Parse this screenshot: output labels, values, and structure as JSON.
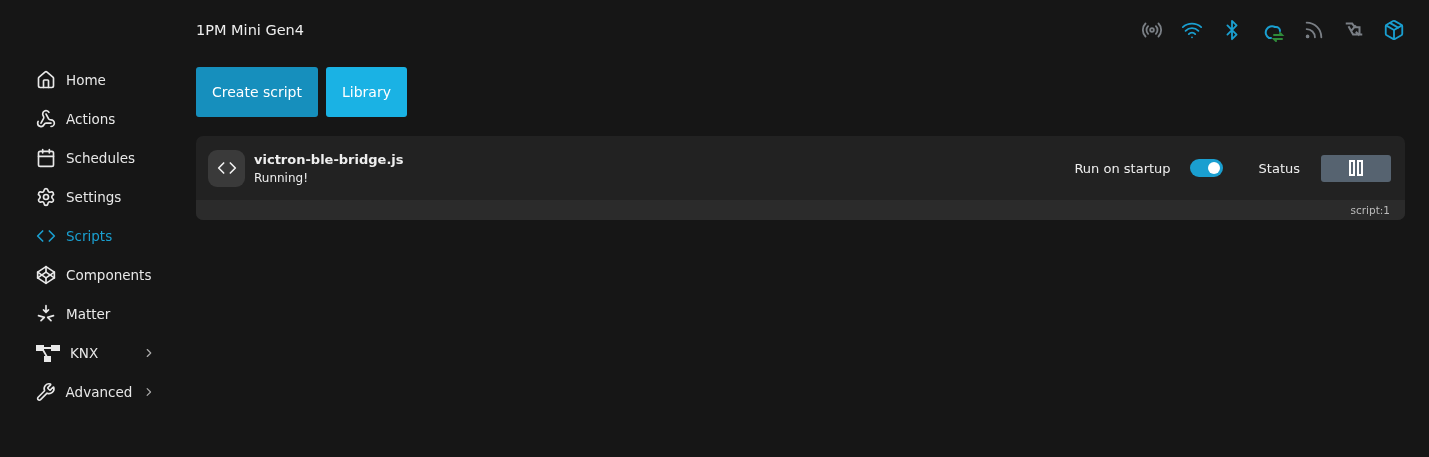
{
  "sidebar": {
    "items": [
      {
        "label": "Home",
        "kind": "home",
        "selected": false,
        "has_submenu": false
      },
      {
        "label": "Actions",
        "kind": "actions",
        "selected": false,
        "has_submenu": false
      },
      {
        "label": "Schedules",
        "kind": "schedules",
        "selected": false,
        "has_submenu": false
      },
      {
        "label": "Settings",
        "kind": "settings",
        "selected": false,
        "has_submenu": false
      },
      {
        "label": "Scripts",
        "kind": "scripts",
        "selected": true,
        "has_submenu": false
      },
      {
        "label": "Components",
        "kind": "components",
        "selected": false,
        "has_submenu": false
      },
      {
        "label": "Matter",
        "kind": "matter",
        "selected": false,
        "has_submenu": false
      },
      {
        "label": "KNX",
        "kind": "knx",
        "selected": false,
        "has_submenu": true
      },
      {
        "label": "Advanced",
        "kind": "advanced",
        "selected": false,
        "has_submenu": true
      }
    ]
  },
  "header": {
    "device_name": "1PM Mini Gen4",
    "status_icons": [
      {
        "kind": "broadcast",
        "active": false
      },
      {
        "kind": "wifi",
        "active": true
      },
      {
        "kind": "bluetooth",
        "active": true
      },
      {
        "kind": "cloud",
        "active": true
      },
      {
        "kind": "rss",
        "active": false
      },
      {
        "kind": "plugin",
        "active": false
      },
      {
        "kind": "package",
        "active": true
      }
    ]
  },
  "toolbar": {
    "buttons": [
      {
        "label": "Create script",
        "kind": "primary"
      },
      {
        "label": "Library",
        "kind": "secondary"
      }
    ]
  },
  "scripts": [
    {
      "name": "victron-ble-bridge.js",
      "state": "Running!",
      "run_on_startup_label": "Run on startup",
      "run_on_startup": true,
      "status_label": "Status",
      "running": true,
      "id": "script:1"
    }
  ]
}
